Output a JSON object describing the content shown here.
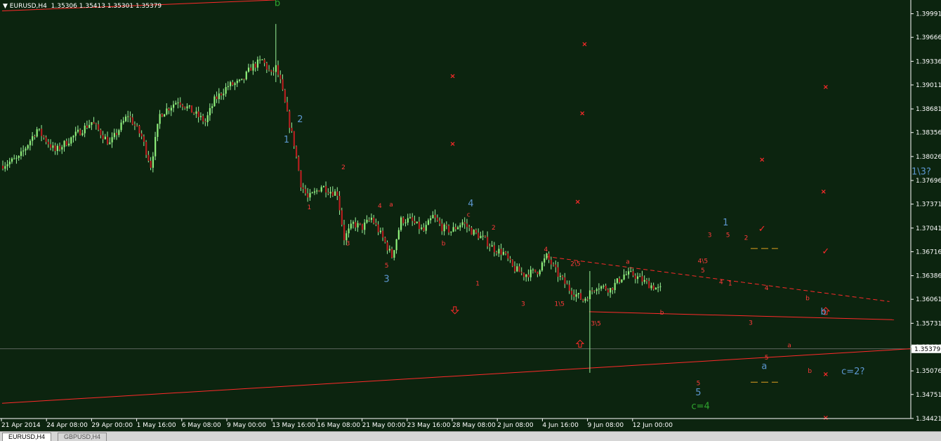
{
  "header": {
    "symbol": "EURUSD,H4",
    "open": "1.35306",
    "high": "1.35413",
    "low": "1.35301",
    "close": "1.35379"
  },
  "tabs": [
    {
      "label": "EURUSD,H4",
      "active": true
    },
    {
      "label": "GBPUSD,H4",
      "active": false
    }
  ],
  "colors": {
    "background": "#0c240f",
    "bull": "#8ff07a",
    "bear": "#b51f1f",
    "wick": "#9af29a",
    "trendline": "#ff2a2a",
    "wave_blue": "#5c96cf",
    "wave_green": "#2fa52f",
    "wave_red": "#ff3a3a",
    "level_orange": "#e0a020",
    "axis_text": "#ffffff"
  },
  "chart_data": {
    "type": "candlestick",
    "y_ticks": [
      "1.39991",
      "1.39666",
      "1.39336",
      "1.39011",
      "1.38681",
      "1.38356",
      "1.38026",
      "1.37696",
      "1.37371",
      "1.37041",
      "1.36716",
      "1.36386",
      "1.36061",
      "1.35731",
      "1.35406",
      "1.35076",
      "1.34751",
      "1.34421"
    ],
    "ylim": [
      1.3442,
      1.4018
    ],
    "current_price": "1.35379",
    "x_ticks": [
      "21 Apr 2014",
      "24 Apr 08:00",
      "29 Apr 00:00",
      "1 May 16:00",
      "6 May 08:00",
      "9 May 00:00",
      "13 May 16:00",
      "16 May 08:00",
      "21 May 00:00",
      "23 May 16:00",
      "28 May 08:00",
      "2 Jun 08:00",
      "4 Jun 16:00",
      "9 Jun 08:00",
      "12 Jun 00:00"
    ],
    "bar_count": 290,
    "price_path": [
      [
        0,
        1.379
      ],
      [
        8,
        1.38
      ],
      [
        16,
        1.384
      ],
      [
        24,
        1.381
      ],
      [
        32,
        1.383
      ],
      [
        40,
        1.385
      ],
      [
        48,
        1.382
      ],
      [
        56,
        1.386
      ],
      [
        62,
        1.383
      ],
      [
        66,
        1.379
      ],
      [
        70,
        1.386
      ],
      [
        78,
        1.388
      ],
      [
        86,
        1.386
      ],
      [
        90,
        1.385
      ],
      [
        94,
        1.388
      ],
      [
        100,
        1.39
      ],
      [
        106,
        1.3905
      ],
      [
        110,
        1.3925
      ],
      [
        115,
        1.3935
      ],
      [
        119,
        1.3915
      ],
      [
        121,
        1.3925
      ],
      [
        123,
        1.3905
      ],
      [
        126,
        1.386
      ],
      [
        129,
        1.382
      ],
      [
        132,
        1.3765
      ],
      [
        135,
        1.3745
      ],
      [
        138,
        1.3752
      ],
      [
        141,
        1.3762
      ],
      [
        145,
        1.3755
      ],
      [
        148,
        1.3752
      ],
      [
        151,
        1.369
      ],
      [
        155,
        1.371
      ],
      [
        159,
        1.3705
      ],
      [
        163,
        1.3718
      ],
      [
        168,
        1.369
      ],
      [
        172,
        1.3665
      ],
      [
        176,
        1.3715
      ],
      [
        180,
        1.3715
      ],
      [
        186,
        1.37
      ],
      [
        190,
        1.372
      ],
      [
        194,
        1.3705
      ],
      [
        198,
        1.37
      ],
      [
        203,
        1.3712
      ],
      [
        207,
        1.37
      ],
      [
        212,
        1.369
      ],
      [
        217,
        1.3675
      ],
      [
        221,
        1.367
      ],
      [
        225,
        1.365
      ],
      [
        230,
        1.364
      ],
      [
        236,
        1.3645
      ],
      [
        240,
        1.3665
      ],
      [
        245,
        1.364
      ],
      [
        250,
        1.362
      ],
      [
        256,
        1.3605
      ],
      [
        262,
        1.3625
      ],
      [
        268,
        1.362
      ],
      [
        274,
        1.364
      ],
      [
        278,
        1.364
      ],
      [
        283,
        1.363
      ],
      [
        289,
        1.362
      ]
    ],
    "volatility": 0.0011,
    "jumps": [
      {
        "bar": 120,
        "high": 1.3985,
        "low": 1.3905
      },
      {
        "bar": 258,
        "high": 1.3645,
        "low": 1.3505
      }
    ],
    "wave_labels": [
      {
        "text": "b",
        "color": "green",
        "bar": 121,
        "price": 1.401,
        "size": "large"
      },
      {
        "text": "2",
        "color": "blue",
        "bar": 131,
        "price": 1.385,
        "size": "large"
      },
      {
        "text": "1",
        "color": "blue",
        "bar": 125,
        "price": 1.3822,
        "size": "large"
      },
      {
        "text": "2",
        "color": "red",
        "bar": 150,
        "price": 1.3785,
        "size": "small"
      },
      {
        "text": "1",
        "color": "red",
        "bar": 135,
        "price": 1.373,
        "size": "small"
      },
      {
        "text": "3",
        "color": "red",
        "bar": 152,
        "price": 1.368,
        "size": "small"
      },
      {
        "text": "4",
        "color": "red",
        "bar": 166,
        "price": 1.3732,
        "size": "small"
      },
      {
        "text": "a",
        "color": "red",
        "bar": 171,
        "price": 1.3734,
        "size": "small"
      },
      {
        "text": "5",
        "color": "red",
        "bar": 169,
        "price": 1.365,
        "size": "small"
      },
      {
        "text": "3",
        "color": "blue",
        "bar": 169,
        "price": 1.363,
        "size": "large"
      },
      {
        "text": "4",
        "color": "blue",
        "bar": 206,
        "price": 1.3734,
        "size": "large"
      },
      {
        "text": "c",
        "color": "red",
        "bar": 205,
        "price": 1.372,
        "size": "small"
      },
      {
        "text": "b",
        "color": "red",
        "bar": 194,
        "price": 1.368,
        "size": "small"
      },
      {
        "text": "2",
        "color": "red",
        "bar": 216,
        "price": 1.3702,
        "size": "small"
      },
      {
        "text": "1",
        "color": "red",
        "bar": 209,
        "price": 1.3625,
        "size": "small"
      },
      {
        "text": "4",
        "color": "red",
        "bar": 239,
        "price": 1.3672,
        "size": "small"
      },
      {
        "text": "3",
        "color": "red",
        "bar": 229,
        "price": 1.3597,
        "size": "small"
      },
      {
        "text": "2\\5",
        "color": "red",
        "bar": 252,
        "price": 1.3652,
        "size": "small"
      },
      {
        "text": "1\\5",
        "color": "red",
        "bar": 245,
        "price": 1.3597,
        "size": "small"
      },
      {
        "text": "3\\5",
        "color": "red",
        "bar": 261,
        "price": 1.357,
        "size": "small"
      },
      {
        "text": "a",
        "color": "red",
        "bar": 275,
        "price": 1.3655,
        "size": "small"
      },
      {
        "text": "b",
        "color": "red",
        "bar": 290,
        "price": 1.3585,
        "size": "small"
      },
      {
        "text": "3",
        "color": "red",
        "bar": 311,
        "price": 1.3692,
        "size": "small"
      },
      {
        "text": "4\\5",
        "color": "red",
        "bar": 308,
        "price": 1.3656,
        "size": "small"
      },
      {
        "text": "5",
        "color": "red",
        "bar": 308,
        "price": 1.3643,
        "size": "small"
      },
      {
        "text": "4",
        "color": "red",
        "bar": 316,
        "price": 1.3627,
        "size": "small"
      },
      {
        "text": "1",
        "color": "red",
        "bar": 320,
        "price": 1.3625,
        "size": "small"
      },
      {
        "text": "1",
        "color": "blue",
        "bar": 318,
        "price": 1.3708,
        "size": "large"
      },
      {
        "text": "5",
        "color": "red",
        "bar": 319,
        "price": 1.3692,
        "size": "small"
      },
      {
        "text": "2",
        "color": "red",
        "bar": 327,
        "price": 1.3688,
        "size": "small"
      },
      {
        "text": "4",
        "color": "red",
        "bar": 336,
        "price": 1.3619,
        "size": "small"
      },
      {
        "text": "3",
        "color": "red",
        "bar": 329,
        "price": 1.3571,
        "size": "small"
      },
      {
        "text": "b",
        "color": "red",
        "bar": 354,
        "price": 1.3605,
        "size": "small"
      },
      {
        "text": "a",
        "color": "red",
        "bar": 346,
        "price": 1.354,
        "size": "small"
      },
      {
        "text": "5",
        "color": "red",
        "bar": 336,
        "price": 1.3523,
        "size": "small"
      },
      {
        "text": "a",
        "color": "blue",
        "bar": 335,
        "price": 1.351,
        "size": "large"
      },
      {
        "text": "b",
        "color": "red",
        "bar": 355,
        "price": 1.3505,
        "size": "small"
      },
      {
        "text": "b",
        "color": "blue",
        "bar": 361,
        "price": 1.3585,
        "size": "large"
      },
      {
        "text": "c=2?",
        "color": "blue",
        "bar": 374,
        "price": 1.3503,
        "size": "large"
      },
      {
        "text": "5",
        "color": "red",
        "bar": 306,
        "price": 1.3488,
        "size": "small"
      },
      {
        "text": "5",
        "color": "blue",
        "bar": 306,
        "price": 1.3474,
        "size": "large"
      },
      {
        "text": "c=4",
        "color": "green",
        "bar": 307,
        "price": 1.3455,
        "size": "large"
      },
      {
        "text": "1\\3?",
        "color": "blue",
        "bar": 404,
        "price": 1.3778,
        "size": "large"
      }
    ],
    "cross_markers": [
      {
        "bar": 256,
        "price": 1.3957
      },
      {
        "bar": 198,
        "price": 1.3913
      },
      {
        "bar": 362,
        "price": 1.3898
      },
      {
        "bar": 255,
        "price": 1.3862
      },
      {
        "bar": 198,
        "price": 1.382
      },
      {
        "bar": 334,
        "price": 1.3798
      },
      {
        "bar": 361,
        "price": 1.3754
      },
      {
        "bar": 253,
        "price": 1.374
      },
      {
        "bar": 362,
        "price": 1.3503
      },
      {
        "bar": 362,
        "price": 1.3443
      }
    ],
    "check_markers": [
      {
        "bar": 334,
        "price": 1.3703
      },
      {
        "bar": 362,
        "price": 1.3672
      }
    ],
    "arrow_markers": [
      {
        "bar": 199,
        "price": 1.3591,
        "dir": "down"
      },
      {
        "bar": 254,
        "price": 1.3545,
        "dir": "up"
      },
      {
        "bar": 362,
        "price": 1.359,
        "dir": "up"
      }
    ],
    "trendlines": [
      {
        "style": "solid",
        "from": [
          0,
          1.3463
        ],
        "to": [
          500,
          1.3538
        ]
      },
      {
        "style": "solid",
        "from": [
          258,
          1.3589
        ],
        "to": [
          392,
          1.3578
        ]
      },
      {
        "style": "dashed",
        "from": [
          239,
          1.3665
        ],
        "to": [
          390,
          1.3603
        ]
      },
      {
        "style": "solid",
        "from": [
          0,
          1.4003
        ],
        "to": [
          120,
          1.4018
        ]
      }
    ],
    "level_lines": [
      {
        "from": [
          329,
          1.3676
        ],
        "to": [
          341,
          1.3676
        ]
      },
      {
        "from": [
          329,
          1.3492
        ],
        "to": [
          341,
          1.3492
        ]
      }
    ]
  }
}
